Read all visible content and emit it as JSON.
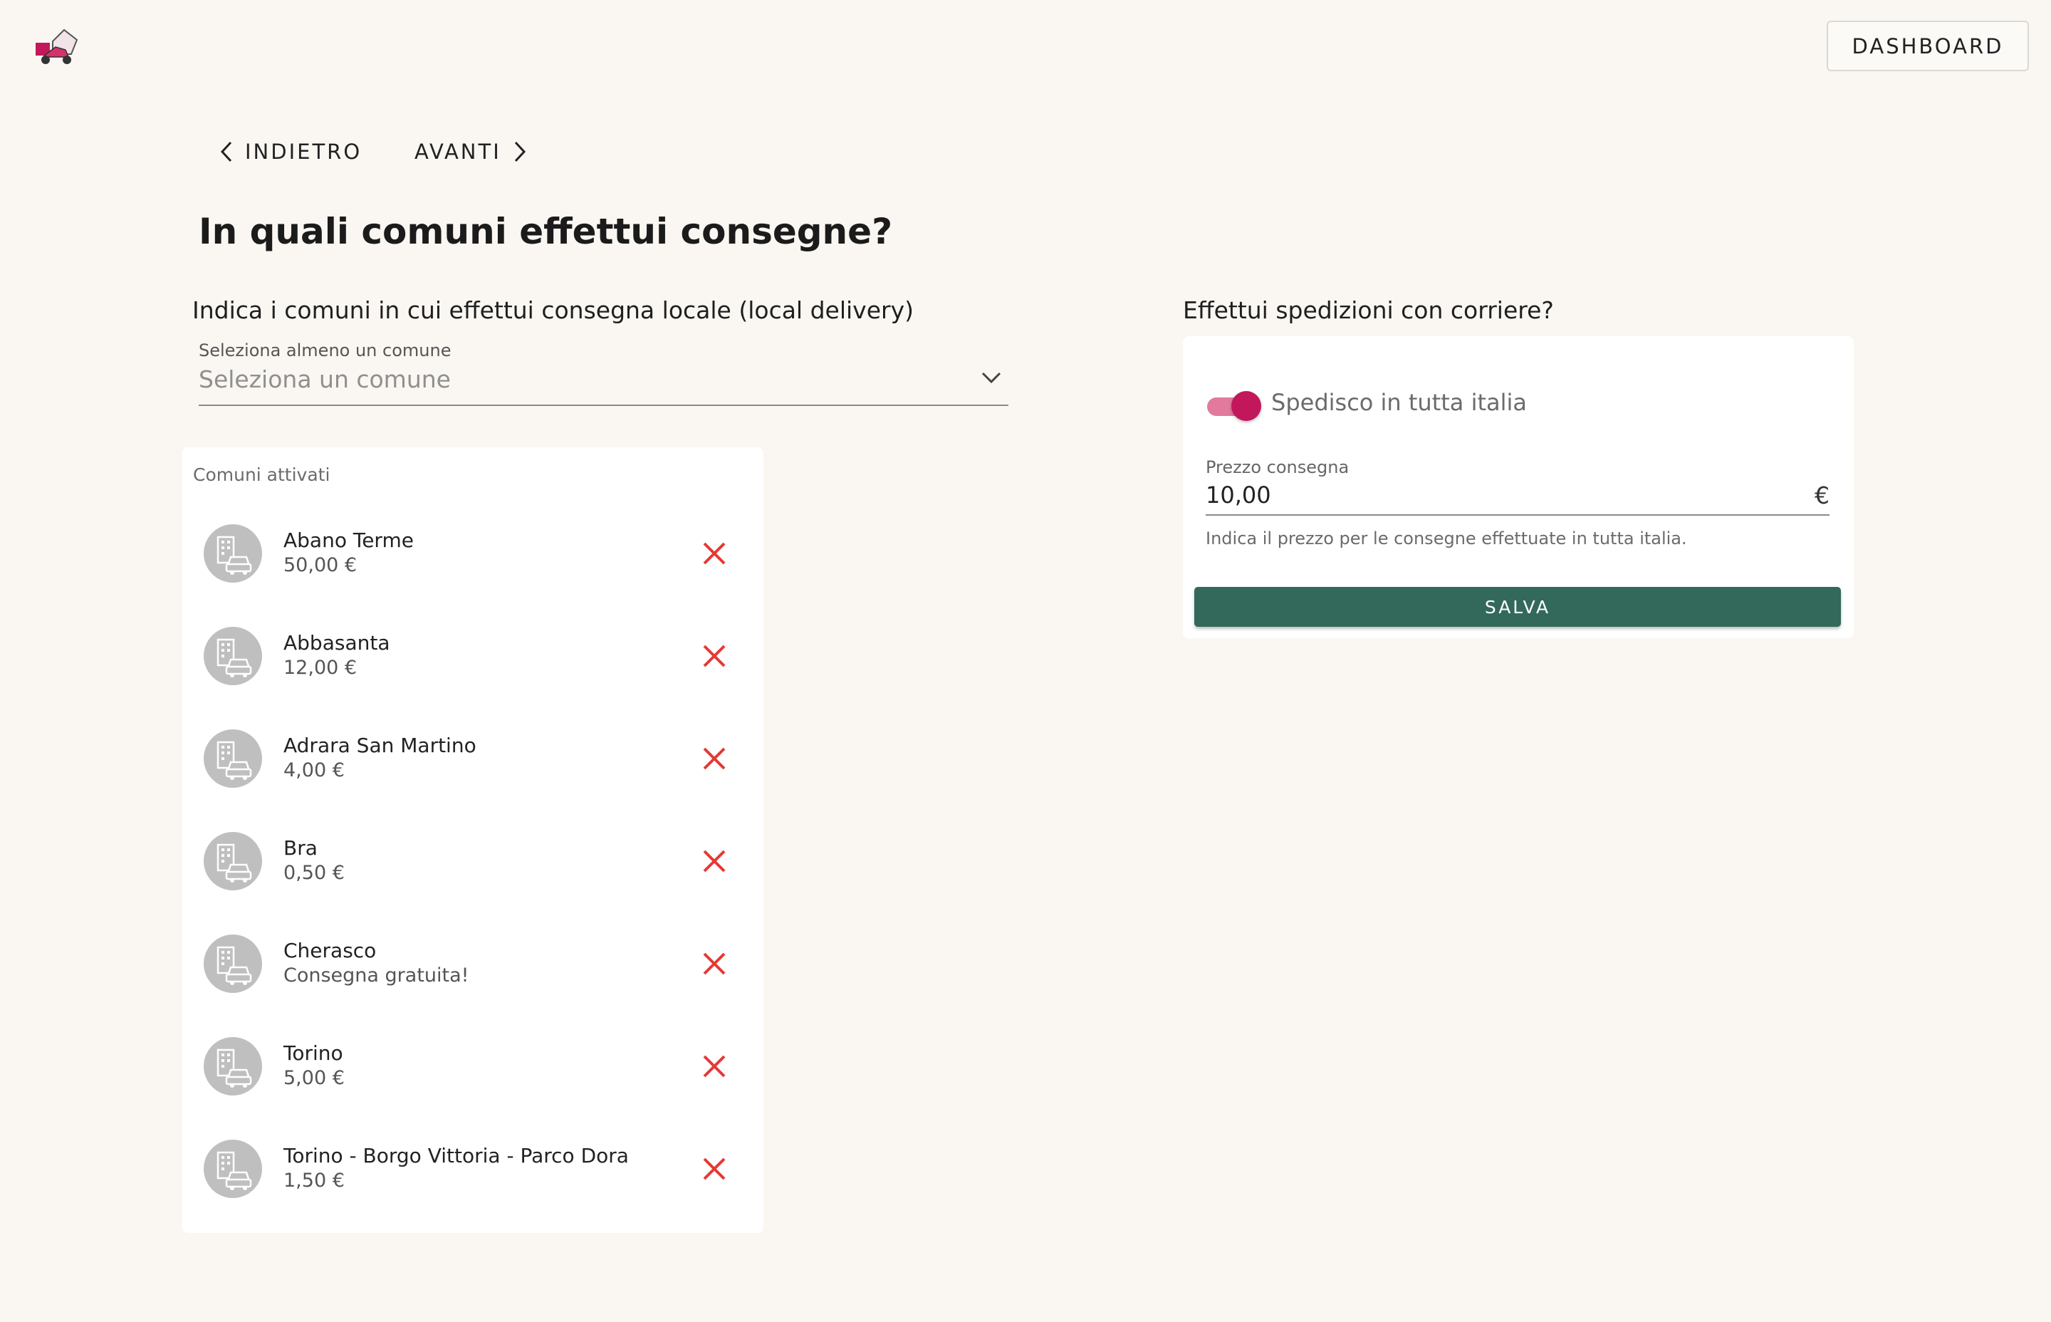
{
  "header": {
    "logo_icon": "scooter-delivery-logo",
    "dashboard_label": "DASHBOARD"
  },
  "nav": {
    "back_label": "INDIETRO",
    "forward_label": "AVANTI"
  },
  "page": {
    "title": "In quali comuni effettui consegne?"
  },
  "local_delivery": {
    "heading": "Indica i comuni in cui effettui consegna locale (local delivery)",
    "select_label": "Seleziona almeno un comune",
    "select_placeholder": "Seleziona un comune",
    "activated_header": "Comuni attivati",
    "items": [
      {
        "name": "Abano Terme",
        "price": "50,00 €"
      },
      {
        "name": "Abbasanta",
        "price": "12,00 €"
      },
      {
        "name": "Adrara San Martino",
        "price": "4,00 €"
      },
      {
        "name": "Bra",
        "price": "0,50 €"
      },
      {
        "name": "Cherasco",
        "price": "Consegna gratuita!"
      },
      {
        "name": "Torino",
        "price": "5,00 €"
      },
      {
        "name": "Torino - Borgo Vittoria - Parco Dora",
        "price": "1,50 €"
      }
    ]
  },
  "courier": {
    "heading": "Effettui spedizioni con corriere?",
    "toggle_label": "Spedisco in tutta italia",
    "toggle_on": true,
    "price_label": "Prezzo consegna",
    "price_value": "10,00",
    "currency": "€",
    "help_text": "Indica il prezzo per le consegne effettuate in tutta italia.",
    "save_label": "SALVA"
  },
  "colors": {
    "background": "#faf7f2",
    "primary_button": "#33695b",
    "toggle_accent": "#c2185b",
    "delete_icon": "#e53935"
  }
}
